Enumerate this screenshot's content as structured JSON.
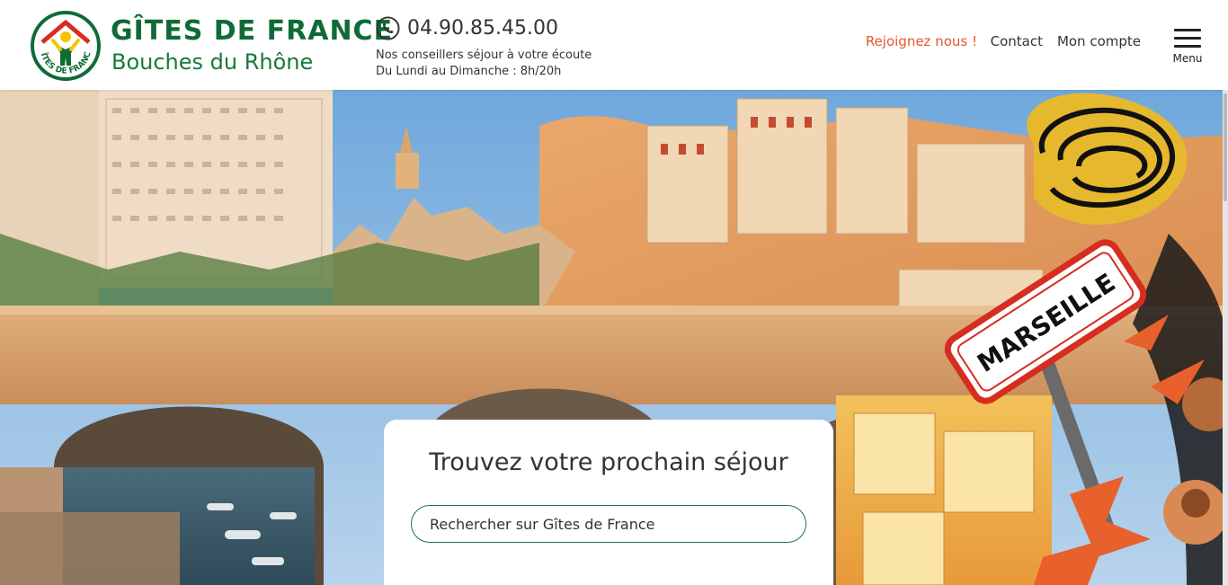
{
  "brand": {
    "title": "GÎTES DE FRANCE",
    "subtitle": "Bouches du Rhône",
    "emblem_text": "GÎTES DE FRANCE",
    "colors": {
      "green": "#0f6b36",
      "light_green": "#157a3b",
      "yellow": "#f5c400",
      "red": "#d62d20"
    }
  },
  "contact": {
    "phone_icon": "phone-icon",
    "phone": "04.90.85.45.00",
    "line1": "Nos conseillers séjour à votre écoute",
    "line2": "Du Lundi au Dimanche : 8h/20h"
  },
  "nav": {
    "join": "Rejoignez nous !",
    "contact": "Contact",
    "account": "Mon compte",
    "menu": "Menu",
    "menu_icon": "hamburger-icon",
    "accent": "#e4572e"
  },
  "hero": {
    "sign_text": "MARSEILLE"
  },
  "search": {
    "title": "Trouvez votre prochain séjour",
    "placeholder": "Rechercher sur Gîtes de France",
    "value": ""
  }
}
